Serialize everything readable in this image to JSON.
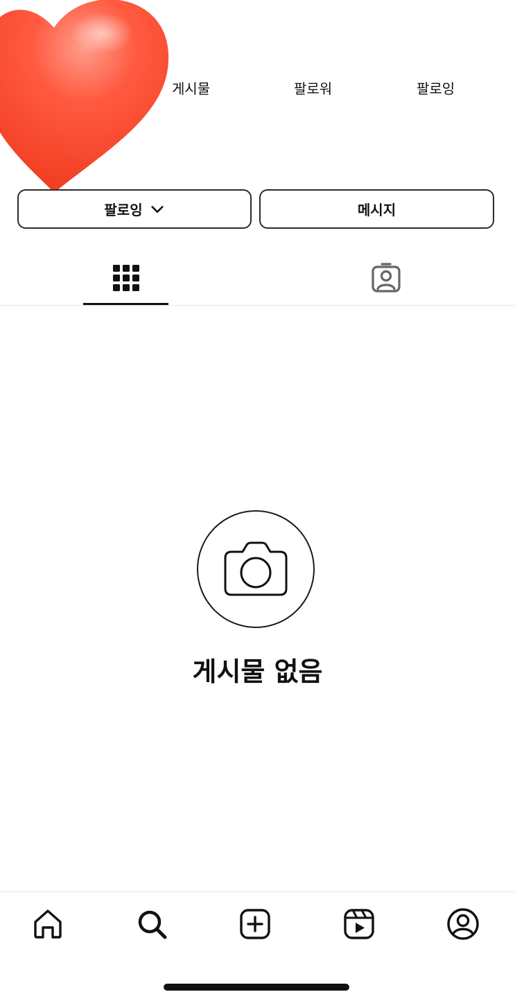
{
  "stats": {
    "posts_label": "게시물",
    "followers_label": "팔로워",
    "following_label": "팔로잉"
  },
  "actions": {
    "following_button_label": "팔로잉",
    "message_button_label": "메시지"
  },
  "tabs": [
    {
      "icon": "grid-icon",
      "selected": true
    },
    {
      "icon": "tagged-icon",
      "selected": false
    }
  ],
  "empty_state": {
    "icon": "camera-icon",
    "title": "게시물 없음"
  },
  "bottom_nav": [
    {
      "icon": "home-icon"
    },
    {
      "icon": "search-icon"
    },
    {
      "icon": "create-icon"
    },
    {
      "icon": "reels-icon"
    },
    {
      "icon": "profile-icon"
    }
  ],
  "colors": {
    "heart": "#ff4a2e",
    "text": "#111111",
    "divider": "#e6e6e6"
  }
}
